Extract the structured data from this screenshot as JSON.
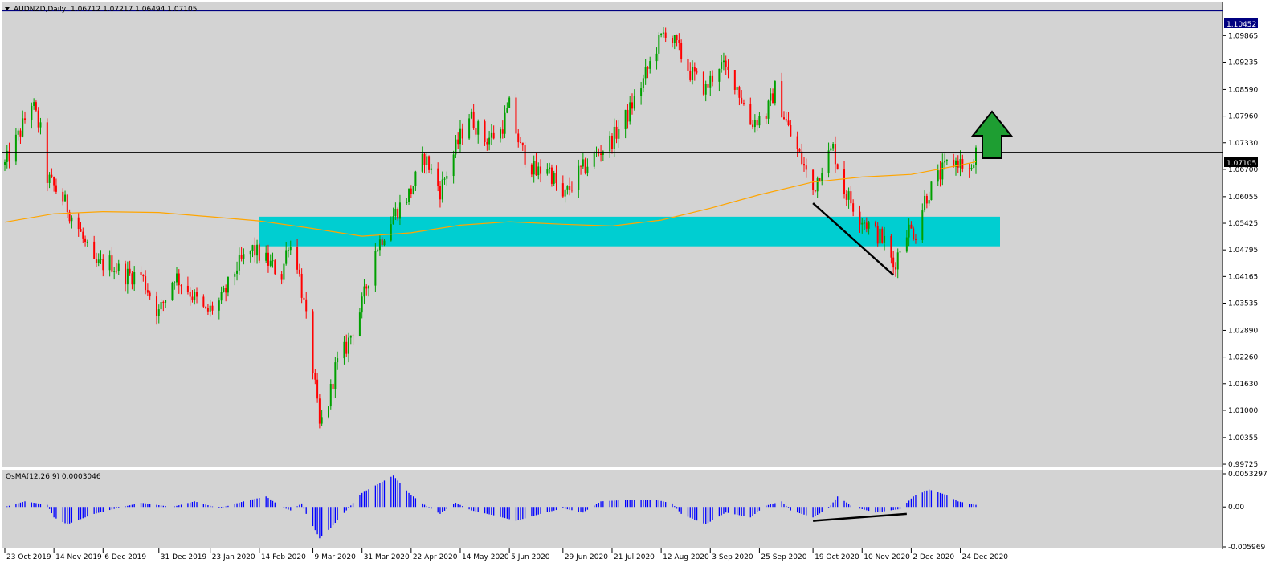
{
  "header": {
    "symbol": "AUDNZD,Daily",
    "ohlc": "1.06712 1.07217 1.06494 1.07105"
  },
  "colors": {
    "background": "#d3d3d3",
    "bull": "#00a000",
    "bear": "#ff0000",
    "zone": "#00ced1",
    "ma": "#ffa500",
    "histogram": "#0000ff",
    "resistance_line": "#000080",
    "price_line": "#000000",
    "arrow": "#1e9e32"
  },
  "chart_data": [
    {
      "type": "candlestick",
      "title": "AUDNZD,Daily",
      "x_ticks": [
        "23 Oct 2019",
        "14 Nov 2019",
        "6 Dec 2019",
        "31 Dec 2019",
        "23 Jan 2020",
        "14 Feb 2020",
        "9 Mar 2020",
        "31 Mar 2020",
        "22 Apr 2020",
        "14 May 2020",
        "5 Jun 2020",
        "29 Jun 2020",
        "21 Jul 2020",
        "12 Aug 2020",
        "3 Sep 2020",
        "25 Sep 2020",
        "19 Oct 2020",
        "10 Nov 2020",
        "2 Dec 2020",
        "24 Dec 2020"
      ],
      "y_ticks": [
        "1.09865",
        "1.09235",
        "1.08590",
        "1.07960",
        "1.07330",
        "1.06700",
        "1.06055",
        "1.05425",
        "1.04795",
        "1.04165",
        "1.03535",
        "1.02890",
        "1.02260",
        "1.01630",
        "1.01000",
        "1.00355",
        "0.99725"
      ],
      "ylim": [
        0.9965,
        1.1065
      ],
      "levels": {
        "resistance": "1.10452",
        "current": "1.07105"
      },
      "zone": {
        "from_date": "14 Feb 2020",
        "to_date": "31 Dec 2020",
        "low": 1.0488,
        "high": 1.0558
      },
      "trend_line": {
        "from": [
          "19 Oct 2020",
          1.059
        ],
        "to": [
          "24 Nov 2020",
          1.042
        ]
      },
      "annotation": "bullish arrow",
      "price_path": [
        [
          "23 Oct 2019",
          1.068
        ],
        [
          "30 Oct 2019",
          1.076
        ],
        [
          "4 Nov 2019",
          1.083
        ],
        [
          "8 Nov 2019",
          1.076
        ],
        [
          "11 Nov 2019",
          1.065
        ],
        [
          "18 Nov 2019",
          1.06
        ],
        [
          "25 Nov 2019",
          1.053
        ],
        [
          "2 Dec 2019",
          1.044
        ],
        [
          "9 Dec 2019",
          1.045
        ],
        [
          "16 Dec 2019",
          1.042
        ],
        [
          "23 Dec 2019",
          1.042
        ],
        [
          "31 Dec 2019",
          1.033
        ],
        [
          "7 Jan 2020",
          1.042
        ],
        [
          "14 Jan 2020",
          1.038
        ],
        [
          "21 Jan 2020",
          1.033
        ],
        [
          "28 Jan 2020",
          1.036
        ],
        [
          "4 Feb 2020",
          1.044
        ],
        [
          "11 Feb 2020",
          1.048
        ],
        [
          "18 Feb 2020",
          1.045
        ],
        [
          "24 Feb 2020",
          1.042
        ],
        [
          "27 Feb 2020",
          1.05
        ],
        [
          "2 Mar 2020",
          1.045
        ],
        [
          "5 Mar 2020",
          1.035
        ],
        [
          "9 Mar 2020",
          1.02
        ],
        [
          "12 Mar 2020",
          1.006
        ],
        [
          "16 Mar 2020",
          1.012
        ],
        [
          "19 Mar 2020",
          1.02
        ],
        [
          "24 Mar 2020",
          1.025
        ],
        [
          "31 Mar 2020",
          1.035
        ],
        [
          "6 Apr 2020",
          1.048
        ],
        [
          "14 Apr 2020",
          1.056
        ],
        [
          "22 Apr 2020",
          1.062
        ],
        [
          "28 Apr 2020",
          1.07
        ],
        [
          "5 May 2020",
          1.062
        ],
        [
          "12 May 2020",
          1.072
        ],
        [
          "18 May 2020",
          1.08
        ],
        [
          "25 May 2020",
          1.074
        ],
        [
          "1 Jun 2020",
          1.076
        ],
        [
          "5 Jun 2020",
          1.082
        ],
        [
          "10 Jun 2020",
          1.072
        ],
        [
          "17 Jun 2020",
          1.066
        ],
        [
          "22 Jun 2020",
          1.068
        ],
        [
          "29 Jun 2020",
          1.06
        ],
        [
          "6 Jul 2020",
          1.066
        ],
        [
          "13 Jul 2020",
          1.07
        ],
        [
          "21 Jul 2020",
          1.074
        ],
        [
          "28 Jul 2020",
          1.08
        ],
        [
          "4 Aug 2020",
          1.088
        ],
        [
          "10 Aug 2020",
          1.096
        ],
        [
          "14 Aug 2020",
          1.1
        ],
        [
          "19 Aug 2020",
          1.096
        ],
        [
          "25 Aug 2020",
          1.09
        ],
        [
          "1 Sep 2020",
          1.086
        ],
        [
          "7 Sep 2020",
          1.092
        ],
        [
          "14 Sep 2020",
          1.088
        ],
        [
          "21 Sep 2020",
          1.078
        ],
        [
          "28 Sep 2020",
          1.08
        ],
        [
          "2 Oct 2020",
          1.086
        ],
        [
          "9 Oct 2020",
          1.075
        ],
        [
          "14 Oct 2020",
          1.069
        ],
        [
          "19 Oct 2020",
          1.062
        ],
        [
          "23 Oct 2020",
          1.068
        ],
        [
          "28 Oct 2020",
          1.072
        ],
        [
          "2 Nov 2020",
          1.062
        ],
        [
          "9 Nov 2020",
          1.056
        ],
        [
          "16 Nov 2020",
          1.052
        ],
        [
          "20 Nov 2020",
          1.05
        ],
        [
          "24 Nov 2020",
          1.044
        ],
        [
          "30 Nov 2020",
          1.053
        ],
        [
          "4 Dec 2020",
          1.052
        ],
        [
          "8 Dec 2020",
          1.06
        ],
        [
          "14 Dec 2020",
          1.065
        ],
        [
          "18 Dec 2020",
          1.068
        ],
        [
          "23 Dec 2020",
          1.069
        ],
        [
          "29 Dec 2020",
          1.066
        ],
        [
          "31 Dec 2020",
          1.071
        ]
      ],
      "moving_average": [
        [
          "23 Oct 2019",
          1.0545
        ],
        [
          "14 Nov 2019",
          1.0565
        ],
        [
          "6 Dec 2019",
          1.057
        ],
        [
          "31 Dec 2019",
          1.0568
        ],
        [
          "23 Jan 2020",
          1.0558
        ],
        [
          "14 Feb 2020",
          1.0548
        ],
        [
          "9 Mar 2020",
          1.053
        ],
        [
          "31 Mar 2020",
          1.0512
        ],
        [
          "22 Apr 2020",
          1.052
        ],
        [
          "14 May 2020",
          1.0538
        ],
        [
          "5 Jun 2020",
          1.0546
        ],
        [
          "29 Jun 2020",
          1.054
        ],
        [
          "21 Jul 2020",
          1.0536
        ],
        [
          "12 Aug 2020",
          1.055
        ],
        [
          "3 Sep 2020",
          1.0578
        ],
        [
          "25 Sep 2020",
          1.061
        ],
        [
          "19 Oct 2020",
          1.064
        ],
        [
          "10 Nov 2020",
          1.0652
        ],
        [
          "2 Dec 2020",
          1.0658
        ],
        [
          "24 Dec 2020",
          1.068
        ],
        [
          "31 Dec 2020",
          1.0688
        ]
      ]
    },
    {
      "type": "histogram",
      "title": "OsMA(12,26,9) 0.0003046",
      "y_ticks": [
        "0.0053297",
        "0.00",
        "-0.005969"
      ],
      "ylim": [
        -0.00597,
        0.00533
      ],
      "trend_line": {
        "from": [
          "19 Oct 2020",
          -0.002
        ],
        "to": [
          "30 Nov 2020",
          -0.001
        ]
      },
      "path": [
        [
          "23 Oct 2019",
          0.0
        ],
        [
          "1 Nov 2019",
          0.0008
        ],
        [
          "11 Nov 2019",
          0.0003
        ],
        [
          "14 Nov 2019",
          -0.0015
        ],
        [
          "20 Nov 2019",
          -0.0025
        ],
        [
          "2 Dec 2019",
          -0.001
        ],
        [
          "12 Dec 2019",
          -0.0002
        ],
        [
          "23 Dec 2019",
          0.0006
        ],
        [
          "6 Jan 2020",
          0.0
        ],
        [
          "16 Jan 2020",
          0.0008
        ],
        [
          "27 Jan 2020",
          -0.0002
        ],
        [
          "7 Feb 2020",
          0.0008
        ],
        [
          "17 Feb 2020",
          0.0015
        ],
        [
          "24 Feb 2020",
          0.0
        ],
        [
          "28 Feb 2020",
          -0.0005
        ],
        [
          "4 Mar 2020",
          0.0005
        ],
        [
          "6 Mar 2020",
          -0.001
        ],
        [
          "12 Mar 2020",
          -0.0045
        ],
        [
          "17 Mar 2020",
          -0.003
        ],
        [
          "24 Mar 2020",
          -0.0005
        ],
        [
          "31 Mar 2020",
          0.002
        ],
        [
          "14 Apr 2020",
          0.0045
        ],
        [
          "21 Apr 2020",
          0.002
        ],
        [
          "27 Apr 2020",
          0.0005
        ],
        [
          "5 May 2020",
          -0.001
        ],
        [
          "12 May 2020",
          0.0006
        ],
        [
          "19 May 2020",
          -0.0005
        ],
        [
          "29 May 2020",
          -0.0012
        ],
        [
          "8 Jun 2020",
          -0.002
        ],
        [
          "19 Jun 2020",
          -0.001
        ],
        [
          "29 Jun 2020",
          -0.0002
        ],
        [
          "8 Jul 2020",
          -0.0008
        ],
        [
          "16 Jul 2020",
          0.0008
        ],
        [
          "27 Jul 2020",
          0.001
        ],
        [
          "10 Aug 2020",
          0.001
        ],
        [
          "17 Aug 2020",
          0.0005
        ],
        [
          "21 Aug 2020",
          -0.001
        ],
        [
          "1 Sep 2020",
          -0.0025
        ],
        [
          "10 Sep 2020",
          -0.0008
        ],
        [
          "21 Sep 2020",
          -0.0015
        ],
        [
          "28 Sep 2020",
          0.0002
        ],
        [
          "5 Oct 2020",
          0.0008
        ],
        [
          "9 Oct 2020",
          -0.0005
        ],
        [
          "19 Oct 2020",
          -0.0015
        ],
        [
          "26 Oct 2020",
          -0.0002
        ],
        [
          "30 Oct 2020",
          0.0015
        ],
        [
          "6 Nov 2020",
          0.0
        ],
        [
          "16 Nov 2020",
          -0.0008
        ],
        [
          "27 Nov 2020",
          -0.0003
        ],
        [
          "3 Dec 2020",
          0.0015
        ],
        [
          "10 Dec 2020",
          0.0025
        ],
        [
          "17 Dec 2020",
          0.0018
        ],
        [
          "23 Dec 2020",
          0.0008
        ],
        [
          "31 Dec 2020",
          0.0003
        ]
      ]
    }
  ]
}
